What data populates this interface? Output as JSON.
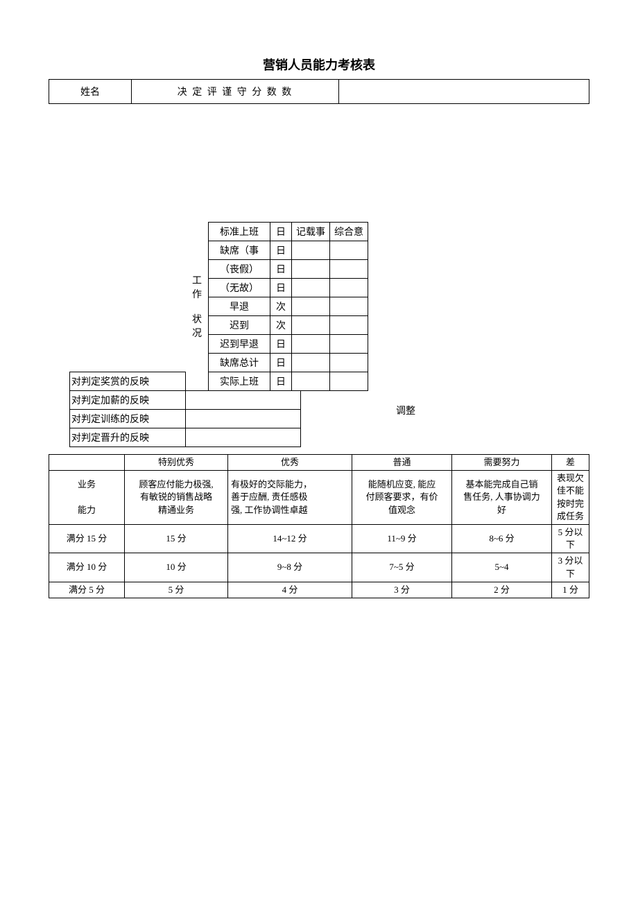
{
  "title": "营销人员能力考核表",
  "top": {
    "name_label": "姓名",
    "overlay_text": "决 定 评 谨 守 分 数 数"
  },
  "attendance": {
    "side_label_1": "工作",
    "side_label_2": "状况",
    "rows": [
      {
        "label": "标准上班",
        "unit": "日"
      },
      {
        "label": "缺席（事",
        "unit": "日"
      },
      {
        "label": "（丧假）",
        "unit": "日"
      },
      {
        "label": "（无故）",
        "unit": "日"
      },
      {
        "label": "早退",
        "unit": "次"
      },
      {
        "label": "迟到",
        "unit": "次"
      },
      {
        "label": "迟到早退",
        "unit": "日"
      },
      {
        "label": "缺席总计",
        "unit": "日"
      },
      {
        "label": "实际上班",
        "unit": "日"
      }
    ],
    "col_record": "记载事",
    "col_opinion": "综合意"
  },
  "reactions": {
    "reward": "对判定奖赏的反映",
    "raise": "对判定加薪的反映",
    "training": "对判定训练的反映",
    "promotion": "对判定晋升的反映"
  },
  "adjust_label": "调整",
  "main": {
    "headers": {
      "blank": "",
      "excellent_plus": "特别优秀",
      "excellent": "优秀",
      "normal": "普通",
      "need_effort": "需要努力",
      "poor": "差"
    },
    "row_label_1": "业务",
    "row_label_2": "能力",
    "desc": {
      "excellent_plus_1": "顾客应付能力极强,",
      "excellent_plus_2": "有敏锐的销售战略",
      "excellent_plus_3": "精通业务",
      "excellent_1": "有极好的交际能力，",
      "excellent_2": "善于应酬, 责任感极",
      "excellent_3": "强, 工作协调性卓越",
      "normal_1": "能随机应变, 能应",
      "normal_2": "付顾客要求，有价",
      "normal_3": "值观念",
      "need_1": "基本能完成自己销",
      "need_2": "售任务, 人事协调力",
      "need_3": "好",
      "poor_1": "表现欠佳不能",
      "poor_2": "按时完成任务"
    },
    "score_rows": [
      {
        "label": "满分 15 分",
        "a": "15 分",
        "b": "14~12 分",
        "c": "11~9 分",
        "d": "8~6 分",
        "e": "5 分以下"
      },
      {
        "label": "满分 10 分",
        "a": "10 分",
        "b": "9~8 分",
        "c": "7~5 分",
        "d": "5~4",
        "e": "3 分以下"
      },
      {
        "label": "满分 5 分",
        "a": "5 分",
        "b": "4 分",
        "c": "3 分",
        "d": "2 分",
        "e": "1 分"
      }
    ]
  }
}
